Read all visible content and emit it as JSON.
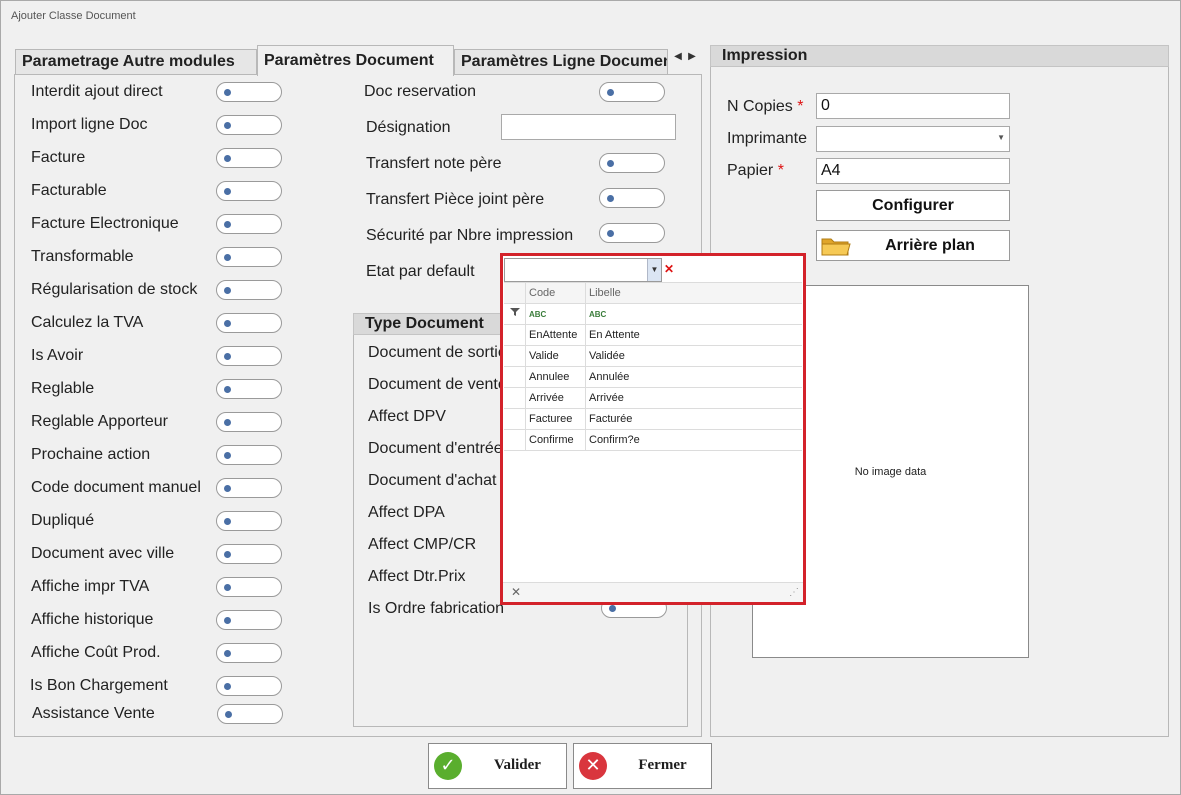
{
  "window": {
    "title": "Ajouter Classe Document"
  },
  "tabs": [
    {
      "label": "Parametrage Autre modules"
    },
    {
      "label": "Paramètres Document"
    },
    {
      "label": "Paramètres Ligne Document"
    }
  ],
  "left_flags": [
    "Interdit ajout direct",
    "Import ligne Doc",
    "Facture",
    "Facturable",
    "Facture Electronique",
    "Transformable",
    "Régularisation de stock",
    "Calculez la TVA",
    "Is Avoir",
    "Reglable",
    "Reglable Apporteur",
    "Prochaine action",
    "Code document manuel",
    "Dupliqué",
    "Document avec ville",
    "Affiche impr TVA",
    "Affiche historique",
    "Affiche Coût Prod.",
    "Is Bon Chargement",
    "Assistance Vente"
  ],
  "middle": {
    "doc_reservation": "Doc reservation",
    "designation": "Désignation",
    "designation_value": "",
    "transfert_note": "Transfert note père",
    "transfert_piece": "Transfert Pièce joint père",
    "securite": "Sécurité par Nbre impression",
    "etat_defaut": "Etat par default"
  },
  "type_document": {
    "title": "Type Document",
    "items": [
      "Document de sortie",
      "Document de vente",
      "Affect DPV",
      "Document d'entrée",
      "Document d'achat",
      "Affect DPA",
      "Affect CMP/CR",
      "Affect Dtr.Prix",
      "Is Ordre fabrication"
    ]
  },
  "impression": {
    "title": "Impression",
    "copies_label": "N Copies",
    "copies_value": "0",
    "imprimante_label": "Imprimante",
    "imprimante_value": "",
    "papier_label": "Papier",
    "papier_value": "A4",
    "required_mark": "*",
    "configurer": "Configurer",
    "arriere_plan": "Arrière plan",
    "no_image": "No image data"
  },
  "dropdown": {
    "columns": [
      "Code",
      "Libelle"
    ],
    "filter_icon": "ABC",
    "rows": [
      {
        "code": "EnAttente",
        "libelle": "En Attente"
      },
      {
        "code": "Valide",
        "libelle": "Validée"
      },
      {
        "code": "Annulee",
        "libelle": "Annulée"
      },
      {
        "code": "Arrivée",
        "libelle": "Arrivée"
      },
      {
        "code": "Facturee",
        "libelle": "Facturée"
      },
      {
        "code": "Confirme",
        "libelle": "Confirm?e"
      }
    ]
  },
  "buttons": {
    "valider": "Valider",
    "fermer": "Fermer"
  },
  "colors": {
    "highlight": "#d3222a",
    "toggle_dot": "#4a6fa5",
    "valider_icon": "#5aae2e",
    "fermer_icon": "#d9363e"
  }
}
